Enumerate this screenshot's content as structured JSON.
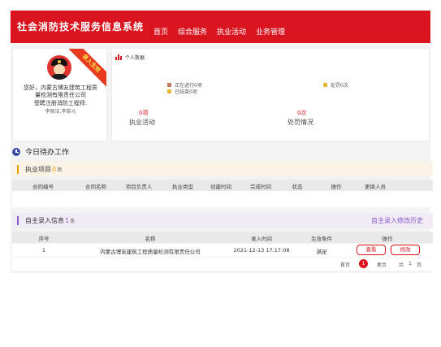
{
  "header": {
    "app_title": "社会消防技术服务信息系统",
    "nav": [
      "首页",
      "综合服务",
      "执业活动",
      "业务管理"
    ]
  },
  "profile": {
    "ribbon": "录入生效",
    "greeting": "您好，内蒙古博友建筑工程质",
    "greeting_2": "量检测有限责任公司",
    "role": "受聘注册消防工程师:",
    "names": "李丽洁,李慕元"
  },
  "personal": {
    "title": "个人数据",
    "legend_ongoing": "正在进行0项",
    "legend_done": "已结束0项",
    "legend_penalty": "处罚0次",
    "practice_count": "0项",
    "practice_label": "执业活动",
    "penalty_count": "0次",
    "penalty_label": "处罚情况",
    "colors": {
      "ongoing": "#c97b5a",
      "done": "#e8b730",
      "penalty": "#e8b730"
    }
  },
  "todo": {
    "title": "今日待办工作"
  },
  "practice_section": {
    "label": "执业项目",
    "count": "0",
    "unit": "项",
    "columns": [
      "合同编号",
      "合同名称",
      "项目负责人",
      "执业类型",
      "创建时间",
      "完成时间",
      "状态",
      "操作",
      "更换人员"
    ]
  },
  "entry_section": {
    "label": "自主录入信息",
    "count": "1",
    "unit": "条",
    "history_link": "自主录入修改历史",
    "columns": [
      "序号",
      "名称",
      "录入时间",
      "生效条件",
      "操作"
    ],
    "rows": [
      {
        "index": "1",
        "name": "内蒙古博友建筑工程质量检测有限责任公司",
        "time": "2021-12-13 17:17:08",
        "condition": "满足",
        "view": "查看",
        "edit": "修改"
      }
    ]
  },
  "pager": {
    "first": "首页",
    "current": "1",
    "last": "尾页",
    "total_prefix": "共",
    "total": "1",
    "total_suffix": "页"
  }
}
